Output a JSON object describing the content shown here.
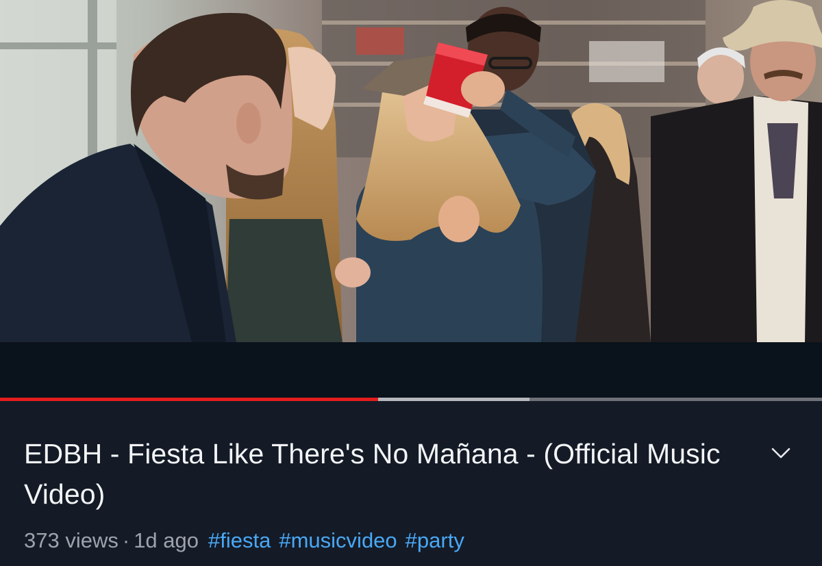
{
  "video": {
    "progress_played": 0.46,
    "progress_buffered": 0.644,
    "colors": {
      "played": "#e11d1d",
      "buffered": "#b6b8bd",
      "track": "#6f7178"
    }
  },
  "title": "EDBH - Fiesta Like There's No Mañana - (Official Music Video)",
  "expand_icon": "chevron-down-icon",
  "meta": {
    "views": "373 views",
    "separator": "·",
    "age": "1d ago"
  },
  "hashtags": [
    "#fiesta",
    "#musicvideo",
    "#party"
  ],
  "colors": {
    "background": "#141b27",
    "title": "#f3f4f6",
    "meta": "#9ea3ab",
    "hashtag": "#4aa8f5"
  }
}
